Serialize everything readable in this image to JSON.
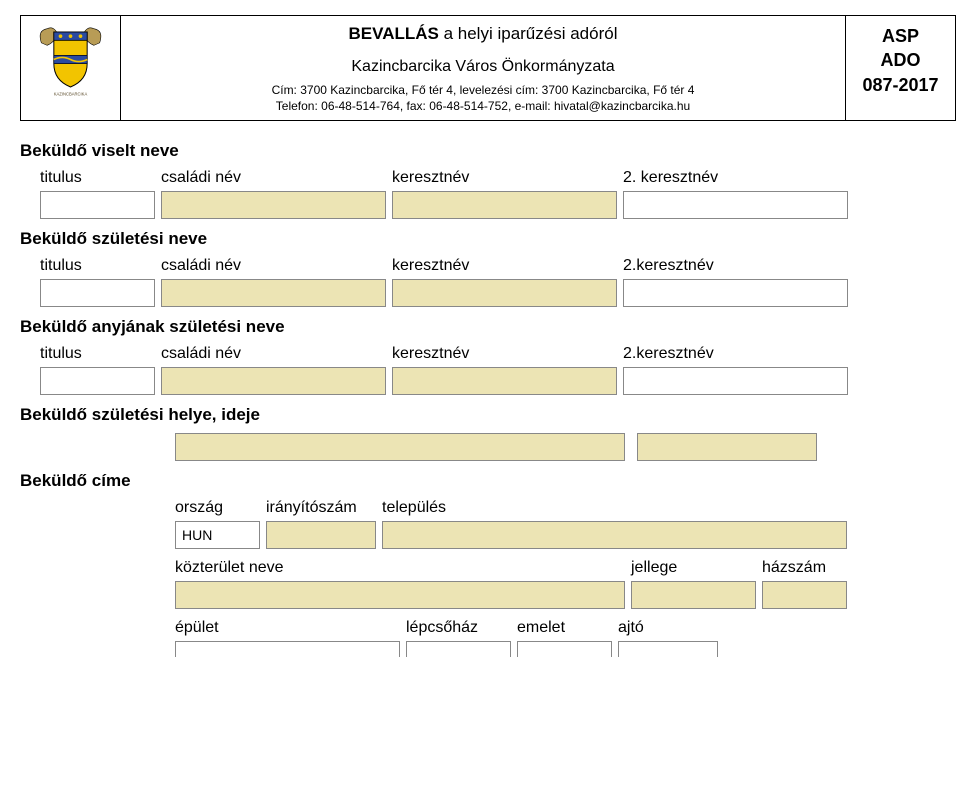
{
  "header": {
    "title_prefix_bold": "BEVALLÁS",
    "title_rest": " a helyi iparűzési adóról",
    "organization": "Kazincbarcika Város Önkormányzata",
    "address_line1": "Cím: 3700 Kazincbarcika, Fő tér 4, levelezési cím: 3700 Kazincbarcika, Fő tér 4",
    "address_line2": "Telefon: 06-48-514-764, fax: 06-48-514-752, e-mail: hivatal@kazincbarcika.hu",
    "code_line1": "ASP",
    "code_line2": "ADO",
    "code_line3": "087-2017"
  },
  "sections": {
    "viselt_neve": "Beküldő viselt neve",
    "szuletesi_neve": "Beküldő születési neve",
    "anyja_neve": "Beküldő anyjának születési neve",
    "szuletesi_helye": "Beküldő születési helye, ideje",
    "cime": "Beküldő címe"
  },
  "labels": {
    "titulus": "titulus",
    "csaladi_nev": "családi név",
    "keresztnev": "keresztnév",
    "keresztnev2_a": "2. keresztnév",
    "keresztnev2_b": "2.keresztnév",
    "orszag": "ország",
    "iranyitoszam": "irányítószám",
    "telepules": "település",
    "kozterulet_neve": "közterület neve",
    "jellege": "jellege",
    "hazszam": "házszám",
    "epulet": "épület",
    "lepcsohaz": "lépcsőház",
    "emelet": "emelet",
    "ajto": "ajtó"
  },
  "fields": {
    "viselt": {
      "titulus": "",
      "csaladi": "",
      "kereszt": "",
      "kereszt2": ""
    },
    "szuletesi": {
      "titulus": "",
      "csaladi": "",
      "kereszt": "",
      "kereszt2": ""
    },
    "anyja": {
      "titulus": "",
      "csaladi": "",
      "kereszt": "",
      "kereszt2": ""
    },
    "szul_hely": "",
    "szul_ido": "",
    "cim": {
      "orszag": "HUN",
      "irsz": "",
      "telepules": "",
      "kozterulet_neve": "",
      "jellege": "",
      "hazszam": "",
      "epulet": "",
      "lepcsohaz": "",
      "emelet": "",
      "ajto": ""
    }
  },
  "colors": {
    "required_bg": "#ece4b4"
  }
}
